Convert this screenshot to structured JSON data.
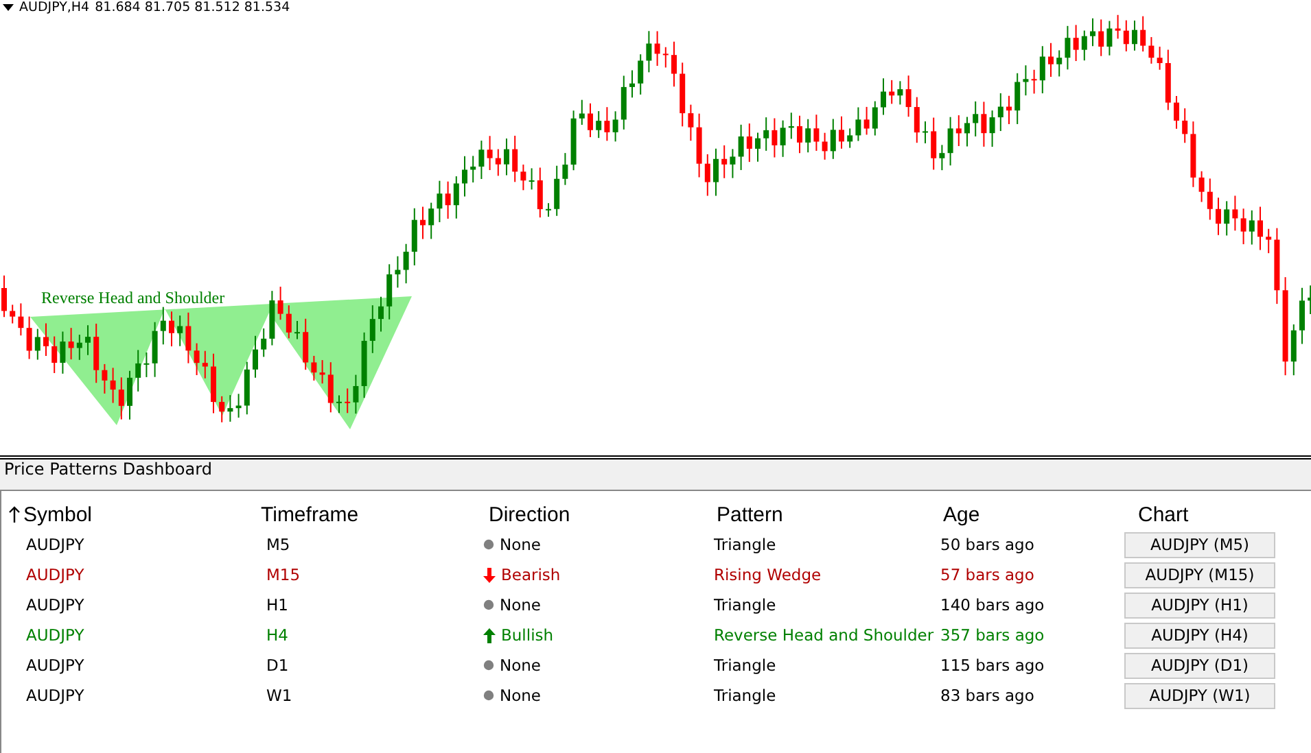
{
  "chart": {
    "symbol": "AUDJPY,H4",
    "prices": "81.684 81.705 81.512 81.534",
    "pattern_label": "Reverse Head and Shoulder"
  },
  "dashboard": {
    "title": "Price Patterns Dashboard",
    "columns": [
      {
        "label": "Symbol",
        "sorted": true
      },
      {
        "label": "Timeframe",
        "sorted": false
      },
      {
        "label": "Direction",
        "sorted": false
      },
      {
        "label": "Pattern",
        "sorted": false
      },
      {
        "label": "Age",
        "sorted": false
      },
      {
        "label": "Chart",
        "sorted": false
      }
    ],
    "rows": [
      {
        "symbol": "AUDJPY",
        "timeframe": "M5",
        "kind": "none",
        "direction": "None",
        "pattern": "Triangle",
        "age": "50 bars ago",
        "chart_button": "AUDJPY (M5)"
      },
      {
        "symbol": "AUDJPY",
        "timeframe": "M15",
        "kind": "bearish",
        "direction": "Bearish",
        "pattern": "Rising Wedge",
        "age": "57 bars ago",
        "chart_button": "AUDJPY (M15)"
      },
      {
        "symbol": "AUDJPY",
        "timeframe": "H1",
        "kind": "none",
        "direction": "None",
        "pattern": "Triangle",
        "age": "140 bars ago",
        "chart_button": "AUDJPY (H1)"
      },
      {
        "symbol": "AUDJPY",
        "timeframe": "H4",
        "kind": "bullish",
        "direction": "Bullish",
        "pattern": "Reverse Head and Shoulder",
        "age": "357 bars ago",
        "chart_button": "AUDJPY (H4)"
      },
      {
        "symbol": "AUDJPY",
        "timeframe": "D1",
        "kind": "none",
        "direction": "None",
        "pattern": "Triangle",
        "age": "115 bars ago",
        "chart_button": "AUDJPY (D1)"
      },
      {
        "symbol": "AUDJPY",
        "timeframe": "W1",
        "kind": "none",
        "direction": "None",
        "pattern": "Triangle",
        "age": "83 bars ago",
        "chart_button": "AUDJPY (W1)"
      }
    ]
  }
}
